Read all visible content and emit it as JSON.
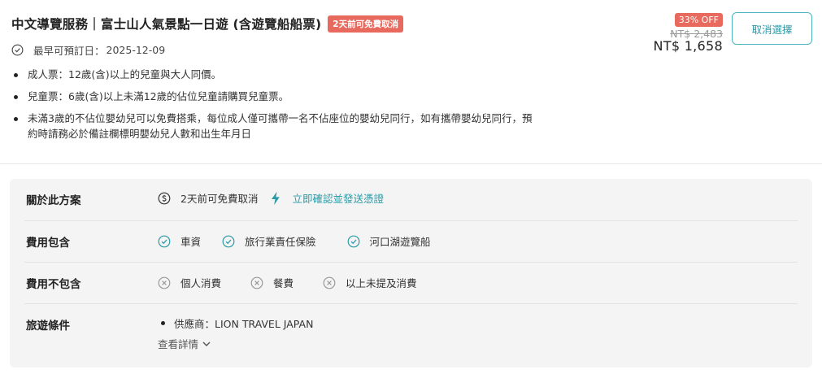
{
  "product": {
    "title": "中文導覽服務｜富士山人氣景點一日遊 (含遊覽船船票)",
    "cancel_badge": "2天前可免費取消",
    "earliest_label": "最早可預訂日：",
    "earliest_date": "2025-12-09",
    "bullets": [
      "成人票：12歲(含)以上的兒童與大人同價。",
      "兒童票：6歲(含)以上未滿12歲的佔位兒童請購買兒童票。",
      "未滿3歲的不佔位嬰幼兒可以免費搭乘，每位成人僅可攜帶一名不佔座位的嬰幼兒同行，如有攜帶嬰幼兒同行，預約時請務必於備註欄標明嬰幼兒人數和出生年月日"
    ]
  },
  "price": {
    "discount": "33% OFF",
    "original": "NT$ 2,483",
    "current": "NT$ 1,658"
  },
  "actions": {
    "cancel_selection": "取消選擇"
  },
  "details": {
    "about": {
      "label": "關於此方案",
      "free_cancel": "2天前可免費取消",
      "instant": "立即確認並發送憑證"
    },
    "included": {
      "label": "費用包含",
      "items": [
        "車資",
        "旅行業責任保險",
        "河口湖遊覽船"
      ]
    },
    "excluded": {
      "label": "費用不包含",
      "items": [
        "個人消費",
        "餐費",
        "以上未提及消費"
      ]
    },
    "conditions": {
      "label": "旅遊條件",
      "supplier": "供應商：LION TRAVEL JAPAN",
      "more": "查看詳情"
    }
  },
  "colors": {
    "accent": "#2a9aa6",
    "badge": "#e86a5f"
  }
}
